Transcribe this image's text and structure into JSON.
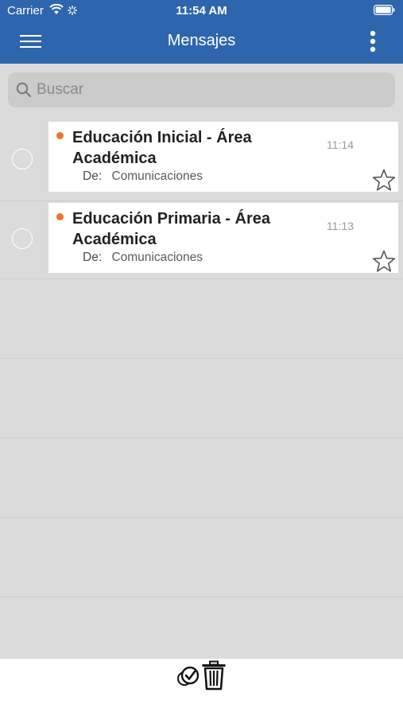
{
  "status_bar": {
    "carrier": "Carrier",
    "time": "11:54 AM"
  },
  "navbar": {
    "title": "Mensajes",
    "menu_icon": "hamburger-menu-icon",
    "more_icon": "more-vertical-icon"
  },
  "search": {
    "placeholder": "Buscar",
    "value": ""
  },
  "messages": [
    {
      "title": "Educación Inicial - Área Académica",
      "from_label": "De:",
      "from": "Comunicaciones",
      "time": "11:14",
      "unread": true,
      "starred": false
    },
    {
      "title": "Educación Primaria - Área Académica",
      "from_label": "De:",
      "from": "Comunicaciones",
      "time": "11:13",
      "unread": true,
      "starred": false
    }
  ],
  "footer": {
    "select_all_icon": "select-all-check-icon",
    "delete_icon": "trash-icon"
  },
  "colors": {
    "header": "#2e66ad",
    "unread_dot": "#f07327",
    "list_background": "#dbdbdb"
  }
}
